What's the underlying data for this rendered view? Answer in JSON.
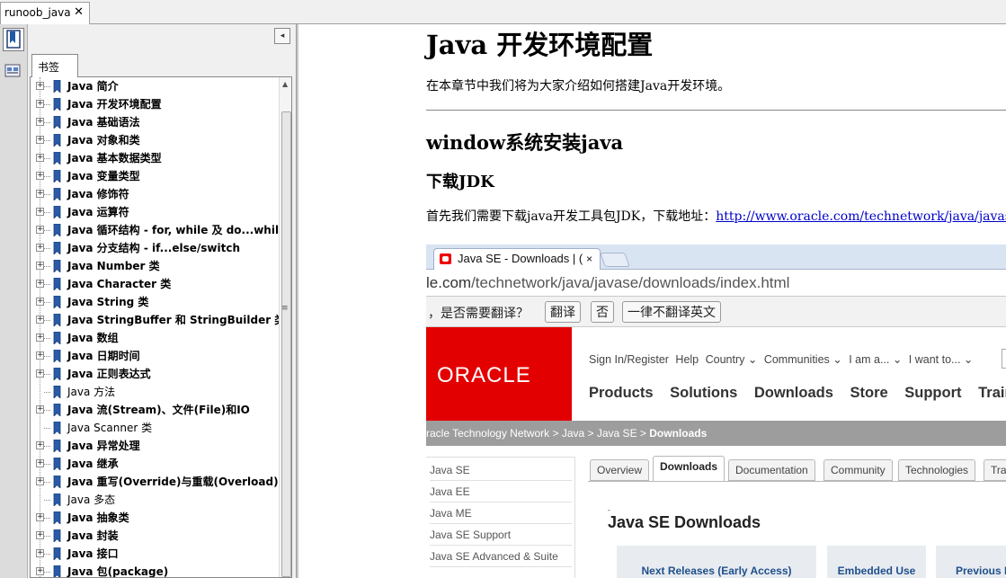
{
  "tab": {
    "title": "runoob_java",
    "close": "✕"
  },
  "panel": {
    "tab_label": "书签",
    "collapse_glyph": "◂",
    "bookmarks": [
      {
        "label": "Java 简介",
        "bold": true,
        "expandable": true
      },
      {
        "label": "Java 开发环境配置",
        "bold": true,
        "expandable": true
      },
      {
        "label": "Java 基础语法",
        "bold": true,
        "expandable": true
      },
      {
        "label": "Java 对象和类",
        "bold": true,
        "expandable": true
      },
      {
        "label": "Java 基本数据类型",
        "bold": true,
        "expandable": true
      },
      {
        "label": "Java 变量类型",
        "bold": true,
        "expandable": true
      },
      {
        "label": "Java 修饰符",
        "bold": true,
        "expandable": true
      },
      {
        "label": "Java 运算符",
        "bold": true,
        "expandable": true
      },
      {
        "label": "Java 循环结构 - for, while 及 do...while",
        "bold": true,
        "expandable": true
      },
      {
        "label": "Java 分支结构 - if...else/switch",
        "bold": true,
        "expandable": true
      },
      {
        "label": "Java Number 类",
        "bold": true,
        "expandable": true
      },
      {
        "label": "Java Character 类",
        "bold": true,
        "expandable": true
      },
      {
        "label": "Java String 类",
        "bold": true,
        "expandable": true
      },
      {
        "label": "Java StringBuffer 和 StringBuilder 类",
        "bold": true,
        "expandable": true
      },
      {
        "label": "Java 数组",
        "bold": true,
        "expandable": true
      },
      {
        "label": "Java 日期时间",
        "bold": true,
        "expandable": true
      },
      {
        "label": "Java 正则表达式",
        "bold": true,
        "expandable": true
      },
      {
        "label": "Java 方法",
        "bold": false,
        "expandable": false
      },
      {
        "label": "Java 流(Stream)、文件(File)和IO",
        "bold": true,
        "expandable": true
      },
      {
        "label": "Java Scanner 类",
        "bold": false,
        "expandable": false
      },
      {
        "label": "Java 异常处理",
        "bold": true,
        "expandable": true
      },
      {
        "label": "Java 继承",
        "bold": true,
        "expandable": true
      },
      {
        "label": "Java 重写(Override)与重载(Overload)",
        "bold": true,
        "expandable": true
      },
      {
        "label": "Java 多态",
        "bold": false,
        "expandable": false
      },
      {
        "label": "Java 抽象类",
        "bold": true,
        "expandable": true
      },
      {
        "label": "Java 封装",
        "bold": true,
        "expandable": true
      },
      {
        "label": "Java 接口",
        "bold": true,
        "expandable": true
      },
      {
        "label": "Java 包(package)",
        "bold": true,
        "expandable": true
      }
    ]
  },
  "doc": {
    "title": "Java 开发环境配置",
    "intro": "在本章节中我们将为大家介绍如何搭建Java开发环境。",
    "h2": "window系统安装java",
    "h3": "下载JDK",
    "p2_prefix": "首先我们需要下载java开发工具包JDK，下载地址：",
    "p2_link": "http://www.oracle.com/technetwork/java/javase/downloads/index.html"
  },
  "screenshot": {
    "tab_title": "Java SE - Downloads | (",
    "tab_close": "×",
    "url_start": "le.com",
    "url_rest": "/technetwork/java/javase/downloads/index.html",
    "translate_prompt": "，是否需要翻译？",
    "translate_btn": "翻译",
    "no_btn": "否",
    "never_btn": "一律不翻译英文",
    "logo": "ORACLE",
    "topnav": [
      "Sign In/Register",
      "Help",
      "Country ⌄",
      "Communities ⌄",
      "I am a... ⌄",
      "I want to... ⌄"
    ],
    "mainnav": [
      "Products",
      "Solutions",
      "Downloads",
      "Store",
      "Support",
      "Training"
    ],
    "breadcrumb": "racle Technology Network  >  Java  >  Java SE  >  ",
    "breadcrumb_current": "Downloads",
    "sidenav": [
      "Java SE",
      "Java EE",
      "Java ME",
      "Java SE Support",
      "Java SE Advanced & Suite"
    ],
    "content_tabs": [
      "Overview",
      "Downloads",
      "Documentation",
      "Community",
      "Technologies",
      "Training"
    ],
    "section_title": "Java SE Downloads",
    "cards": [
      "Next Releases (Early Access)",
      "Embedded Use",
      "Previous Releases"
    ]
  }
}
